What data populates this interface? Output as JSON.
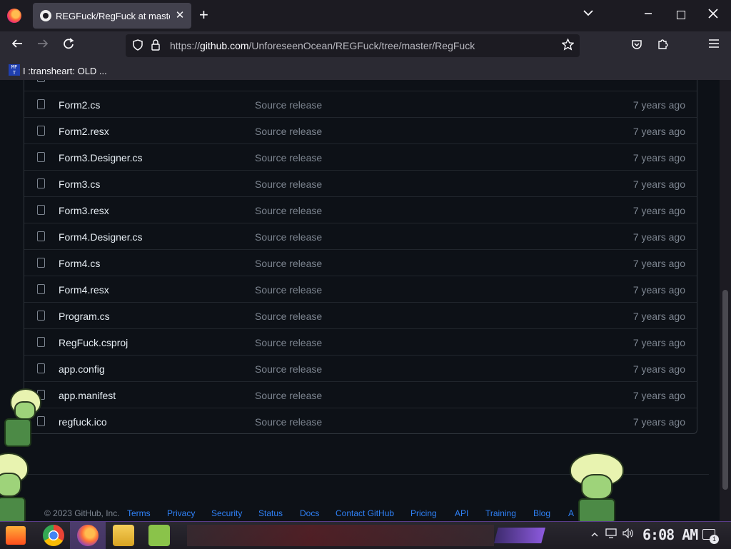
{
  "browser": {
    "tab_title": "REGFuck/RegFuck at master",
    "tab_close_glyph": "✕",
    "new_tab_glyph": "+",
    "tab_list_glyph": "⌄",
    "url_prefix": "https://",
    "url_host": "github.com",
    "url_path": "/UnforeseenOcean/REGFuck/tree/master/RegFuck",
    "bookmark_icon_text": "MF T",
    "bookmark_label": "I :transheart: OLD ..."
  },
  "files": [
    {
      "name": "Form2.cs",
      "message": "Source release",
      "date": "7 years ago"
    },
    {
      "name": "Form2.resx",
      "message": "Source release",
      "date": "7 years ago"
    },
    {
      "name": "Form3.Designer.cs",
      "message": "Source release",
      "date": "7 years ago"
    },
    {
      "name": "Form3.cs",
      "message": "Source release",
      "date": "7 years ago"
    },
    {
      "name": "Form3.resx",
      "message": "Source release",
      "date": "7 years ago"
    },
    {
      "name": "Form4.Designer.cs",
      "message": "Source release",
      "date": "7 years ago"
    },
    {
      "name": "Form4.cs",
      "message": "Source release",
      "date": "7 years ago"
    },
    {
      "name": "Form4.resx",
      "message": "Source release",
      "date": "7 years ago"
    },
    {
      "name": "Program.cs",
      "message": "Source release",
      "date": "7 years ago"
    },
    {
      "name": "RegFuck.csproj",
      "message": "Source release",
      "date": "7 years ago"
    },
    {
      "name": "app.config",
      "message": "Source release",
      "date": "7 years ago"
    },
    {
      "name": "app.manifest",
      "message": "Source release",
      "date": "7 years ago"
    },
    {
      "name": "regfuck.ico",
      "message": "Source release",
      "date": "7 years ago"
    }
  ],
  "footer": {
    "copyright": "© 2023 GitHub, Inc.",
    "links": [
      "Terms",
      "Privacy",
      "Security",
      "Status",
      "Docs",
      "Contact GitHub",
      "Pricing",
      "API",
      "Training",
      "Blog",
      "A"
    ]
  },
  "taskbar": {
    "clock": "6:08 AM",
    "notification_count": "1"
  },
  "colors": {
    "page_bg": "#0d1117",
    "link": "#2f81f7",
    "muted_text": "#7d8590",
    "primary_text": "#e6edf3"
  }
}
